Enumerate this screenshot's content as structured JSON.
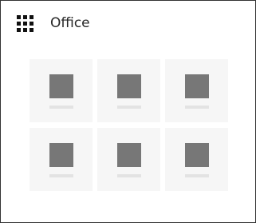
{
  "header": {
    "title": "Office",
    "launcher_icon": "waffle-icon"
  },
  "tiles": [
    {
      "icon": "app-placeholder-icon",
      "label": ""
    },
    {
      "icon": "app-placeholder-icon",
      "label": ""
    },
    {
      "icon": "app-placeholder-icon",
      "label": ""
    },
    {
      "icon": "app-placeholder-icon",
      "label": ""
    },
    {
      "icon": "app-placeholder-icon",
      "label": ""
    },
    {
      "icon": "app-placeholder-icon",
      "label": ""
    }
  ],
  "colors": {
    "border": "#333333",
    "tile_bg": "#f6f6f6",
    "icon_placeholder": "#777777",
    "label_placeholder": "#e3e3e3"
  }
}
